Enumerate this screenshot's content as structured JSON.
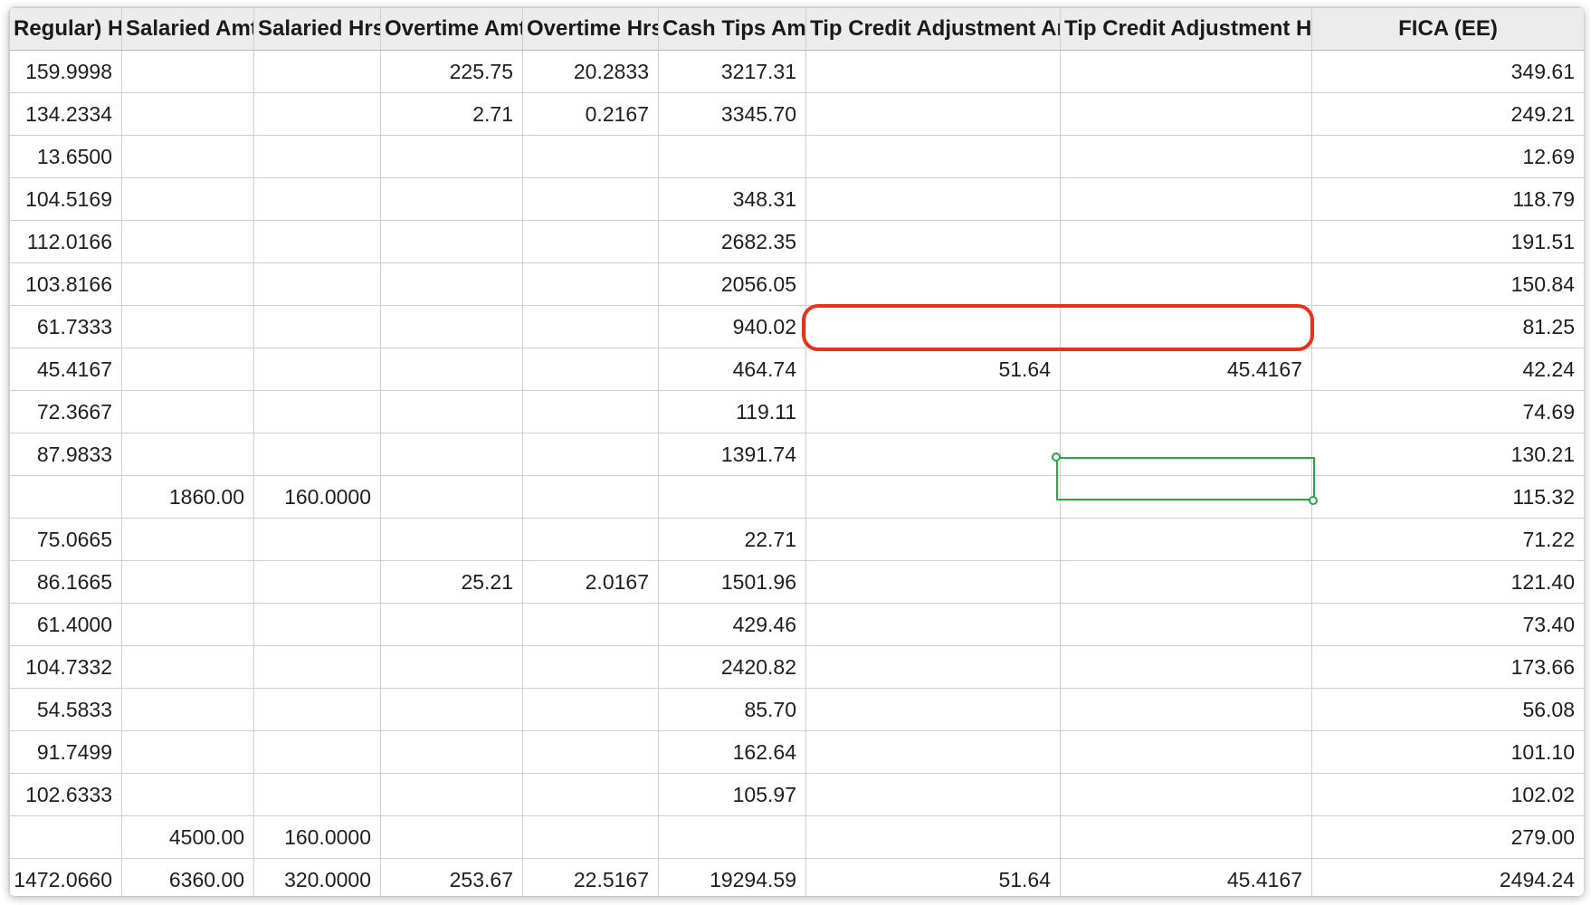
{
  "columns": [
    "Regular) Hrs",
    "Salaried Amt",
    "Salaried Hrs",
    "Overtime Amt",
    "Overtime Hrs",
    "Cash Tips Amt",
    "Tip Credit Adjustment Amt",
    "Tip Credit Adjustment Hrs",
    "FICA (EE)"
  ],
  "rows": [
    [
      "159.9998",
      "",
      "",
      "225.75",
      "20.2833",
      "3217.31",
      "",
      "",
      "349.61"
    ],
    [
      "134.2334",
      "",
      "",
      "2.71",
      "0.2167",
      "3345.70",
      "",
      "",
      "249.21"
    ],
    [
      "13.6500",
      "",
      "",
      "",
      "",
      "",
      "",
      "",
      "12.69"
    ],
    [
      "104.5169",
      "",
      "",
      "",
      "",
      "348.31",
      "",
      "",
      "118.79"
    ],
    [
      "112.0166",
      "",
      "",
      "",
      "",
      "2682.35",
      "",
      "",
      "191.51"
    ],
    [
      "103.8166",
      "",
      "",
      "",
      "",
      "2056.05",
      "",
      "",
      "150.84"
    ],
    [
      "61.7333",
      "",
      "",
      "",
      "",
      "940.02",
      "",
      "",
      "81.25"
    ],
    [
      "45.4167",
      "",
      "",
      "",
      "",
      "464.74",
      "51.64",
      "45.4167",
      "42.24"
    ],
    [
      "72.3667",
      "",
      "",
      "",
      "",
      "119.11",
      "",
      "",
      "74.69"
    ],
    [
      "87.9833",
      "",
      "",
      "",
      "",
      "1391.74",
      "",
      "",
      "130.21"
    ],
    [
      "",
      "1860.00",
      "160.0000",
      "",
      "",
      "",
      "",
      "",
      "115.32"
    ],
    [
      "75.0665",
      "",
      "",
      "",
      "",
      "22.71",
      "",
      "",
      "71.22"
    ],
    [
      "86.1665",
      "",
      "",
      "25.21",
      "2.0167",
      "1501.96",
      "",
      "",
      "121.40"
    ],
    [
      "61.4000",
      "",
      "",
      "",
      "",
      "429.46",
      "",
      "",
      "73.40"
    ],
    [
      "104.7332",
      "",
      "",
      "",
      "",
      "2420.82",
      "",
      "",
      "173.66"
    ],
    [
      "54.5833",
      "",
      "",
      "",
      "",
      "85.70",
      "",
      "",
      "56.08"
    ],
    [
      "91.7499",
      "",
      "",
      "",
      "",
      "162.64",
      "",
      "",
      "101.10"
    ],
    [
      "102.6333",
      "",
      "",
      "",
      "",
      "105.97",
      "",
      "",
      "102.02"
    ],
    [
      "",
      "4500.00",
      "160.0000",
      "",
      "",
      "",
      "",
      "",
      "279.00"
    ]
  ],
  "totals": [
    "1472.0660",
    "6360.00",
    "320.0000",
    "253.67",
    "22.5167",
    "19294.59",
    "51.64",
    "45.4167",
    "2494.24"
  ],
  "colors": {
    "highlight": "#e8321e",
    "selection": "#28a745",
    "header_bg": "#ececec",
    "grid": "#cfcfcf"
  }
}
